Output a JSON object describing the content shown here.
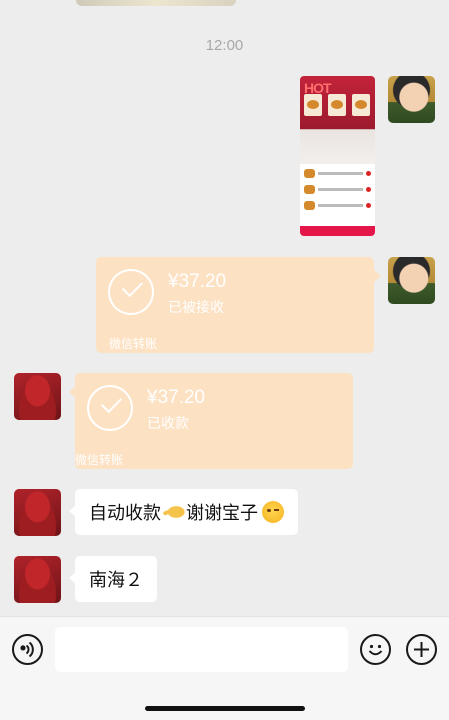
{
  "chat": {
    "timestamp": "12:00",
    "messages": [
      {
        "type": "image",
        "sender": "me",
        "description_icon": "screenshot-image"
      },
      {
        "type": "transfer",
        "sender": "me",
        "amount": "¥37.20",
        "status": "已被接收",
        "source": "微信转账"
      },
      {
        "type": "transfer",
        "sender": "other",
        "amount": "¥37.20",
        "status": "已收款",
        "source": "微信转账"
      },
      {
        "type": "text",
        "sender": "other",
        "parts": [
          "自动收款",
          "谢谢宝子"
        ]
      },
      {
        "type": "text",
        "sender": "other",
        "text": "南海２"
      }
    ]
  },
  "screenshot": {
    "logo_text": "HOT"
  },
  "input_bar": {
    "voice_icon": "voice-icon",
    "emoji_icon": "emoji-icon",
    "plus_icon": "plus-icon",
    "placeholder": ""
  },
  "colors": {
    "background": "#ededed",
    "transfer_card": "#fde1c3",
    "bubble": "#ffffff",
    "timestamp": "#a8a8a8"
  }
}
